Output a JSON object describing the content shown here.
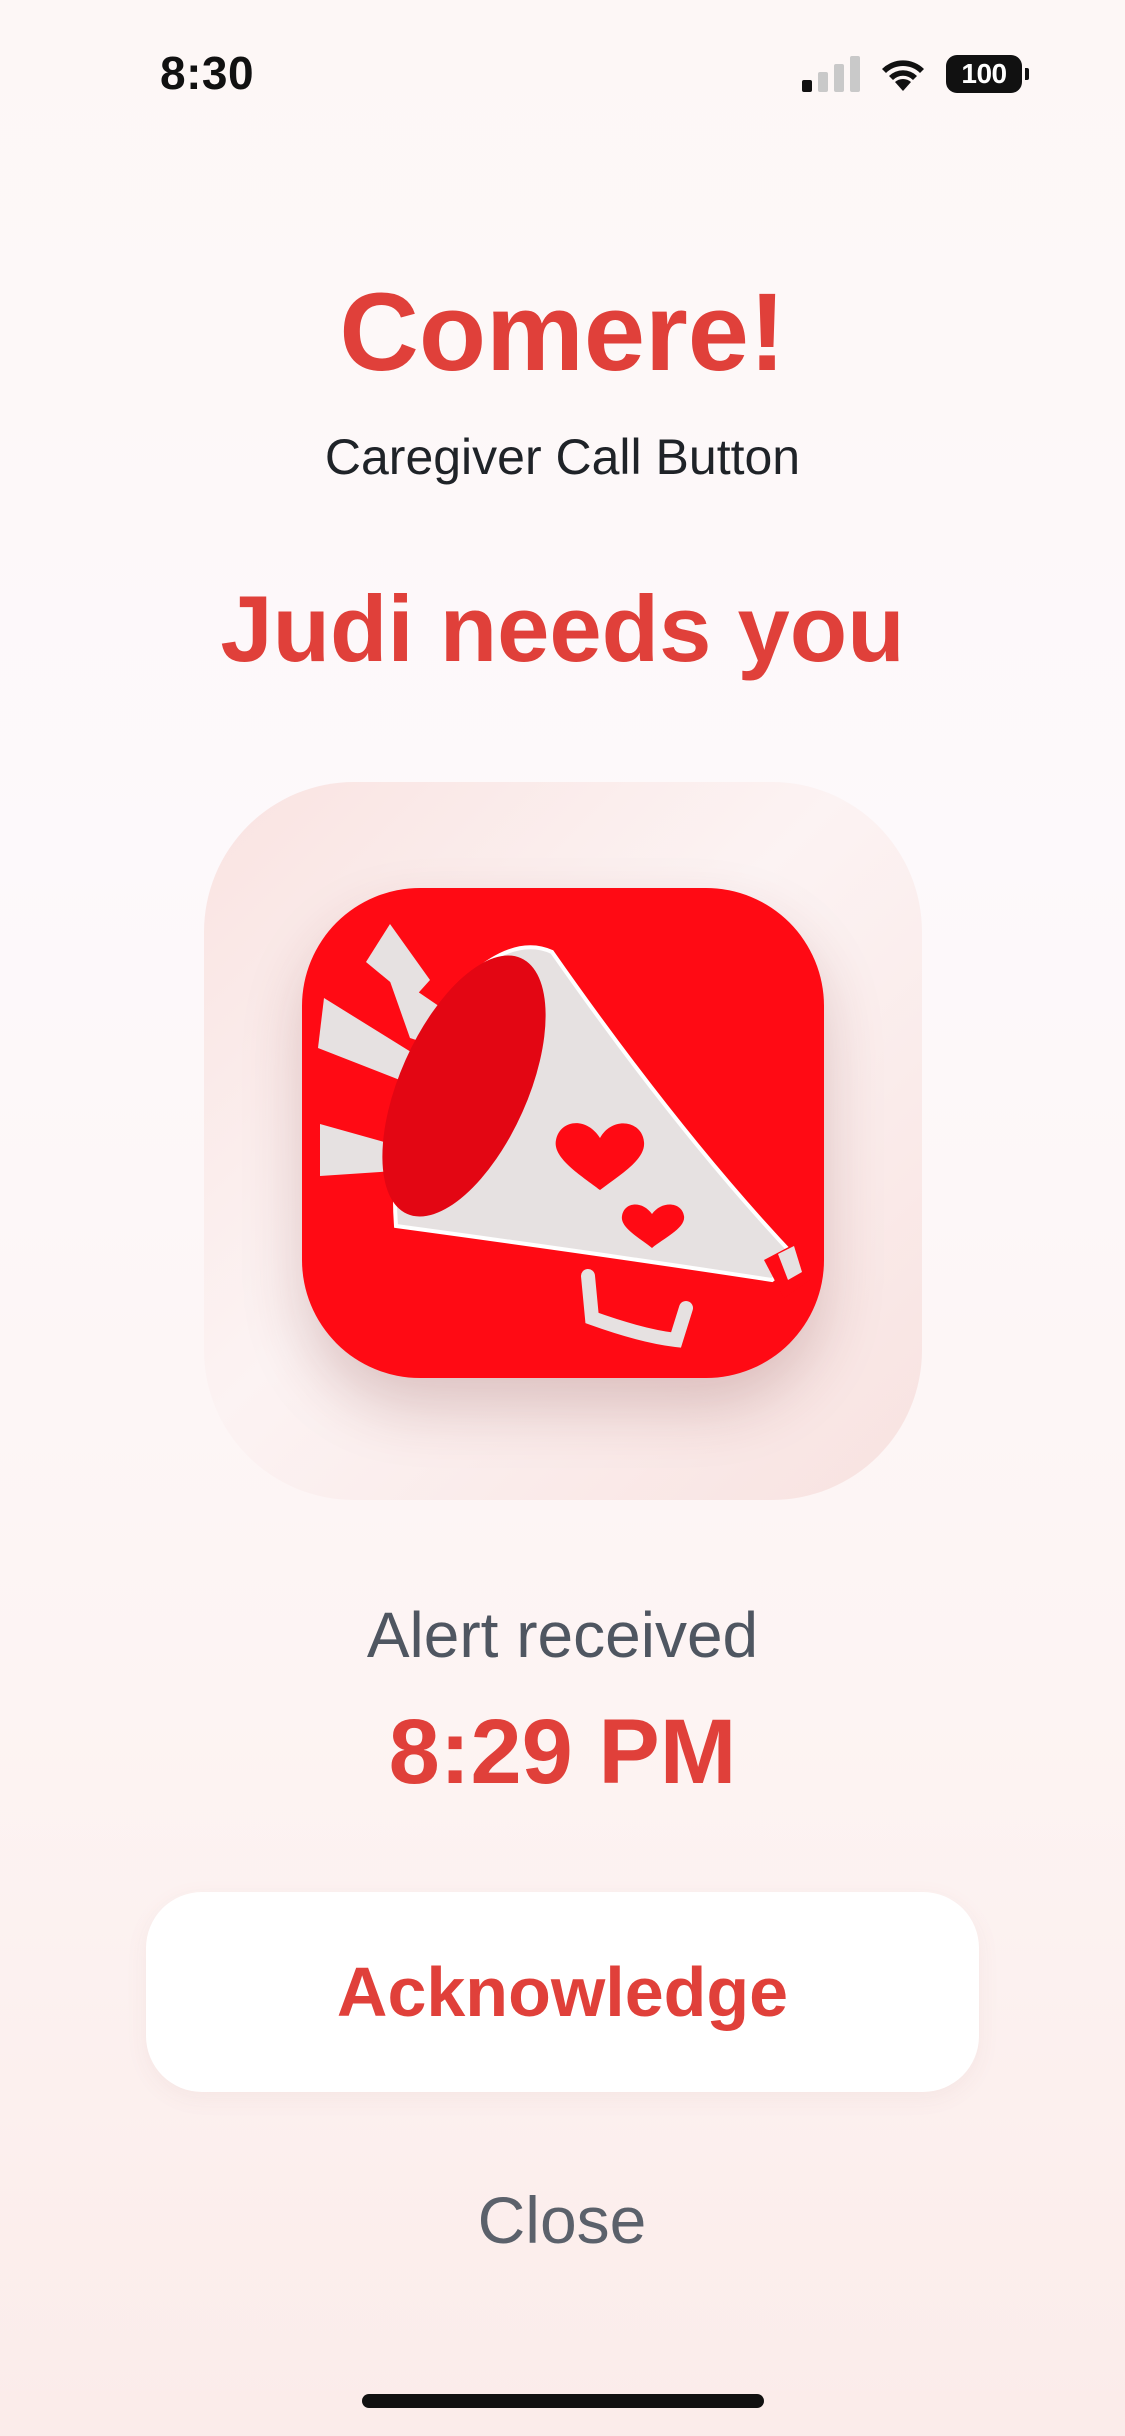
{
  "status_bar": {
    "time": "8:30",
    "battery": "100",
    "icons": [
      "cellular-signal-icon",
      "wifi-icon",
      "battery-icon"
    ]
  },
  "header": {
    "app_title": "Comere!",
    "app_subtitle": "Caregiver Call Button"
  },
  "alert": {
    "heading": "Judi needs you",
    "icon": "megaphone-hearts-icon",
    "received_label": "Alert received",
    "received_time": "8:29 PM"
  },
  "actions": {
    "acknowledge_label": "Acknowledge",
    "close_label": "Close"
  },
  "colors": {
    "accent": "#e0403a",
    "icon_background": "#ff0a14",
    "secondary_text": "#5b616b"
  }
}
